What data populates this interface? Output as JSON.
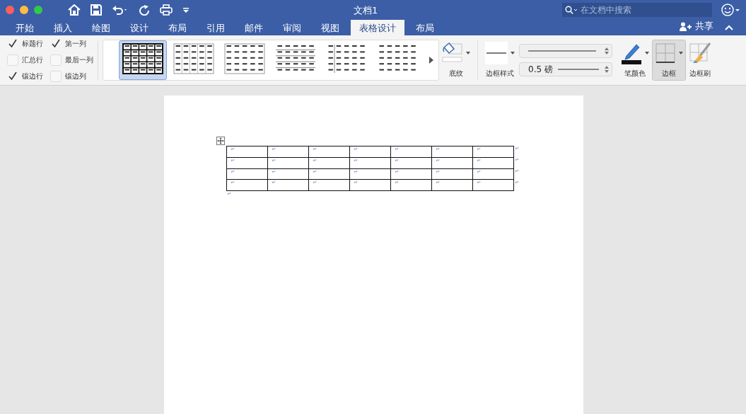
{
  "window": {
    "title": "文档1"
  },
  "search": {
    "placeholder": "在文档中搜索"
  },
  "tabs": [
    {
      "label": "开始",
      "selected": false
    },
    {
      "label": "插入",
      "selected": false
    },
    {
      "label": "绘图",
      "selected": false
    },
    {
      "label": "设计",
      "selected": false
    },
    {
      "label": "布局",
      "selected": false
    },
    {
      "label": "引用",
      "selected": false
    },
    {
      "label": "邮件",
      "selected": false
    },
    {
      "label": "审阅",
      "selected": false
    },
    {
      "label": "视图",
      "selected": false
    },
    {
      "label": "表格设计",
      "selected": true
    },
    {
      "label": "布局",
      "selected": false
    }
  ],
  "share_button": "共享",
  "style_options": [
    [
      {
        "label": "标题行",
        "checked": true
      },
      {
        "label": "汇总行",
        "checked": false
      },
      {
        "label": "镶边行",
        "checked": true
      }
    ],
    [
      {
        "label": "第一列",
        "checked": true
      },
      {
        "label": "最后一列",
        "checked": false
      },
      {
        "label": "镶边列",
        "checked": false
      }
    ]
  ],
  "table_styles": [
    {
      "kind": "grid-bold",
      "selected": true
    },
    {
      "kind": "grid-light",
      "selected": false
    },
    {
      "kind": "grid-plain",
      "selected": false
    },
    {
      "kind": "rows",
      "selected": false
    },
    {
      "kind": "first-col",
      "selected": false
    },
    {
      "kind": "plain",
      "selected": false
    }
  ],
  "shading_button": "底纹",
  "border_styles_button": "边框样式",
  "pen_weight": "0.5 磅",
  "pen_color_button": "笔颜色",
  "borders_button": {
    "label": "边框",
    "selected": true
  },
  "border_painter_button": "边框刷",
  "document": {
    "table": {
      "rows": [
        [
          "↵",
          "↵",
          "↵",
          "↵",
          "↵",
          "↵",
          "↵"
        ],
        [
          "↵",
          "↵",
          "↵",
          "↵",
          "↵",
          "↵",
          "↵"
        ],
        [
          "↵",
          "↵",
          "↵",
          "↵",
          "↵",
          "↵",
          "↵"
        ],
        [
          "↵",
          "↵",
          "↵",
          "↵",
          "↵",
          "↵",
          "↵"
        ]
      ],
      "row_end_marks": [
        "↵",
        "↵",
        "↵",
        "↵"
      ]
    },
    "paragraph_mark": "↵"
  }
}
